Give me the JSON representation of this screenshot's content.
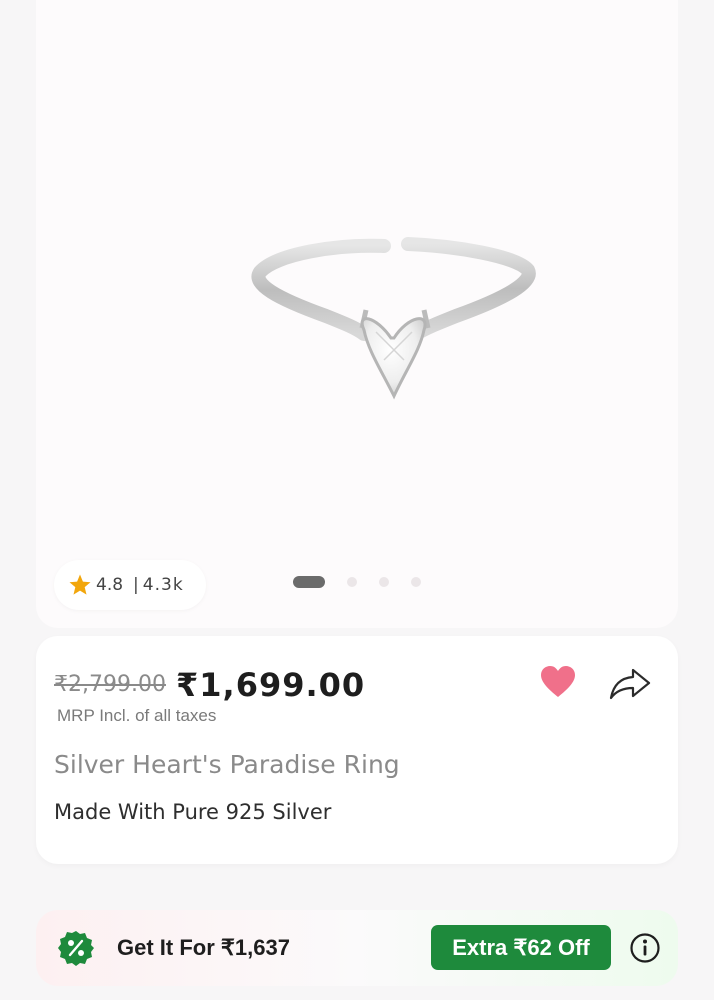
{
  "product_gallery": {
    "image_alt": "silver heart ring",
    "rating": "4.8",
    "rating_separator": "|",
    "review_count": "4.3k",
    "carousel_pages": 4,
    "carousel_active_index": 0
  },
  "pricing": {
    "mrp": "₹2,799.00",
    "price": "₹1,699.00",
    "mrp_note": "MRP Incl. of all taxes"
  },
  "product": {
    "title": "Silver Heart's Paradise Ring",
    "subtitle": "Made With Pure 925 Silver"
  },
  "actions": {
    "wishlist_icon": "heart-icon",
    "share_icon": "share-arrow-icon"
  },
  "offer": {
    "icon": "percent-badge-icon",
    "text": "Get It For ₹1,637",
    "extra_label": "Extra ₹62 Off",
    "info_icon": "info-icon"
  },
  "colors": {
    "wishlist_heart": "#f0708a",
    "offer_green": "#1e8a3c",
    "star": "#f2a60c"
  }
}
